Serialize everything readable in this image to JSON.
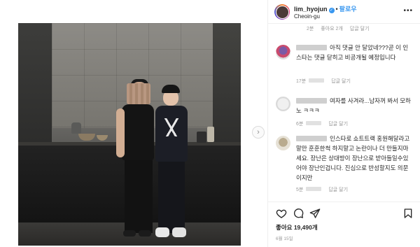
{
  "header": {
    "username": "lim_hyojun",
    "follow_label": "팔로우",
    "location": "Cheoin-gu",
    "more_label": "•••"
  },
  "comments_top_meta": {
    "time": "2분",
    "likes": "좋아요 2개",
    "reply": "답글 달기"
  },
  "comments": [
    {
      "text": "아직 댓글 안 달았네???곧 이 인스타는 댓글 닫히고 비공개될 예정입니다",
      "time": "17분",
      "reply": "답글 달기"
    },
    {
      "text": "여자를 사겨라...남자꺼 봐서 모하노 ㅋㅋㅋ",
      "time": "6분",
      "reply": "답글 달기"
    },
    {
      "text": "인스타로 쇼트트랙 홍원해달라고 말만 훈훈한척 하지말고 논란이나 더 만들지마세요. 장난은 상대방이 장난으로 받아들일수있어야 장난인겁니다. 진심으로 반성할지도 의문이지만",
      "time": "5분",
      "reply": "답글 달기"
    }
  ],
  "footer": {
    "likes": "좋아요 19,490개",
    "date": "6월 15일"
  },
  "icons": {
    "heart": "heart-icon",
    "comment": "comment-icon",
    "share": "share-icon",
    "bookmark": "bookmark-icon",
    "next": "chevron-right-icon"
  },
  "colors": {
    "accent": "#3897f0",
    "text": "#262626",
    "muted": "#999999"
  }
}
